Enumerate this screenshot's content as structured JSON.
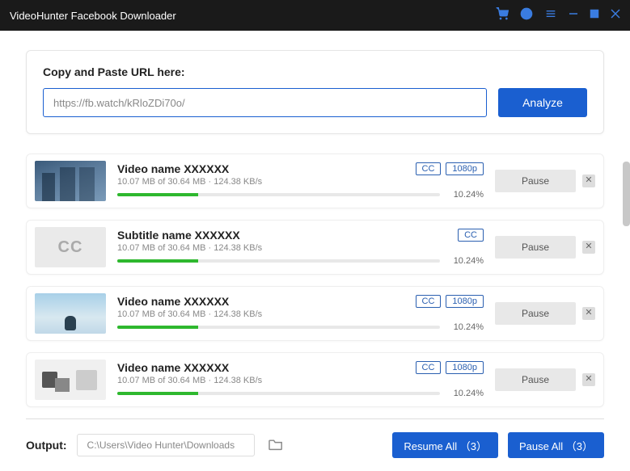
{
  "titlebar": {
    "title": "VideoHunter Facebook Downloader"
  },
  "url_section": {
    "label": "Copy and Paste URL here:",
    "value": "https://fb.watch/kRloZDi70o/",
    "analyze_label": "Analyze"
  },
  "downloads": [
    {
      "thumb_class": "thumb-buildings",
      "title": "Video name XXXXXX",
      "stats": "10.07 MB of 30.64 MB · 124.38 KB/s",
      "percent": "10.24%",
      "cc": "CC",
      "quality": "1080p",
      "action": "Pause"
    },
    {
      "thumb_class": "thumb-cc",
      "thumb_text": "CC",
      "title": "Subtitle name XXXXXX",
      "stats": "10.07 MB of 30.64 MB · 124.38 KB/s",
      "percent": "10.24%",
      "cc": "CC",
      "quality": null,
      "action": "Pause"
    },
    {
      "thumb_class": "thumb-person",
      "title": "Video name XXXXXX",
      "stats": "10.07 MB of 30.64 MB · 124.38 KB/s",
      "percent": "10.24%",
      "cc": "CC",
      "quality": "1080p",
      "action": "Pause"
    },
    {
      "thumb_class": "thumb-desk",
      "title": "Video name XXXXXX",
      "stats": "10.07 MB of 30.64 MB · 124.38 KB/s",
      "percent": "10.24%",
      "cc": "CC",
      "quality": "1080p",
      "action": "Pause"
    }
  ],
  "footer": {
    "output_label": "Output:",
    "output_path": "C:\\Users\\Video Hunter\\Downloads",
    "resume_all": "Resume All （3）",
    "pause_all": "Pause All （3）"
  }
}
